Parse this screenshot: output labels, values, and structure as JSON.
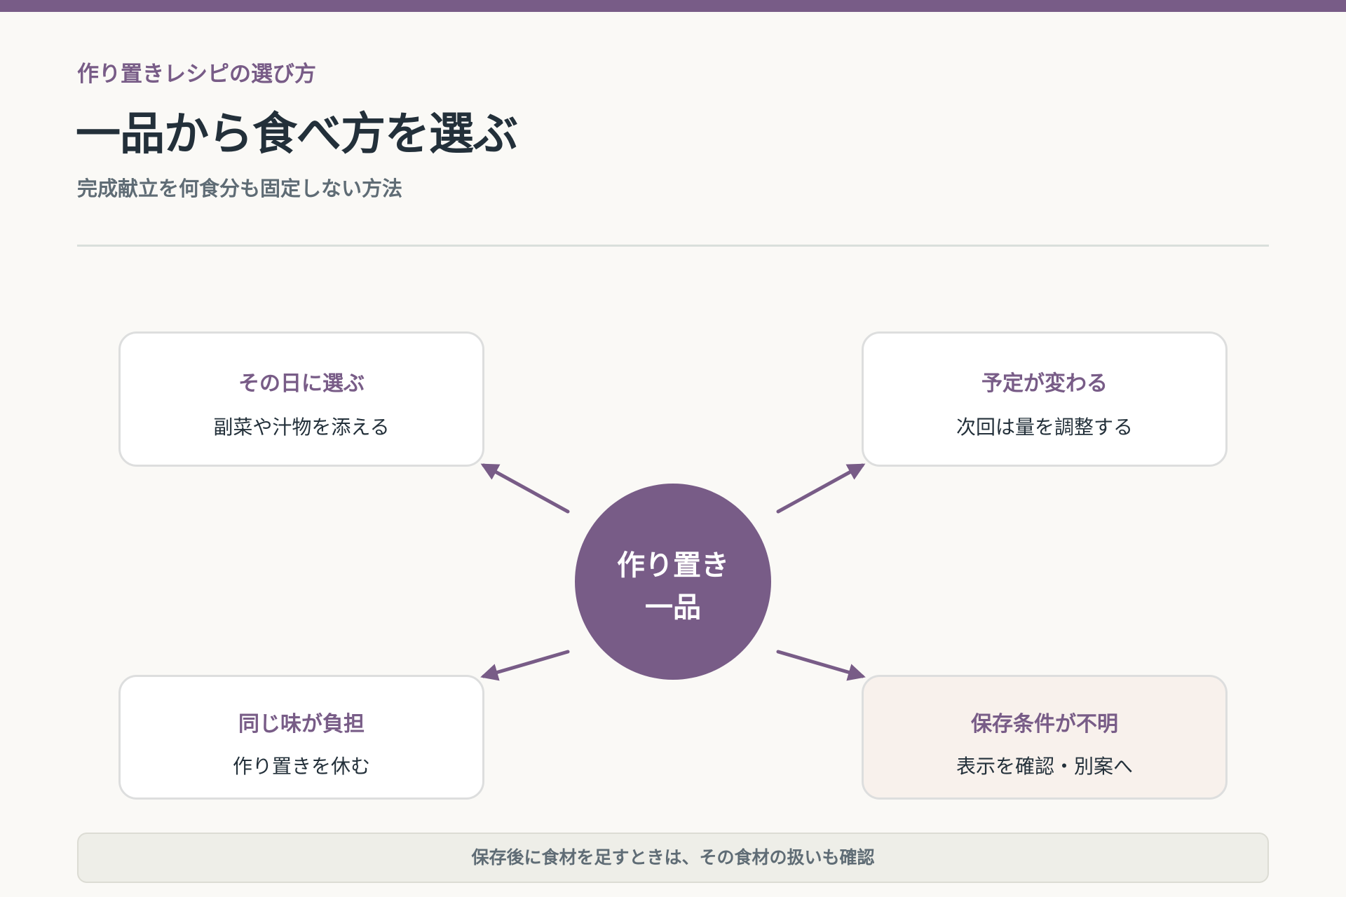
{
  "header": {
    "eyebrow": "作り置きレシピの選び方",
    "title": "一品から食べ方を選ぶ",
    "subtitle": "完成献立を何食分も固定しない方法"
  },
  "diagram": {
    "hub": {
      "line1": "作り置き",
      "line2": "一品"
    },
    "branches": [
      {
        "title": "その日に選ぶ",
        "text": "副菜や汁物を添える"
      },
      {
        "title": "予定が変わる",
        "text": "次回は量を調整する"
      },
      {
        "title": "同じ味が負担",
        "text": "作り置きを休む"
      },
      {
        "title": "保存条件が不明",
        "text": "表示を確認・別案へ"
      }
    ]
  },
  "footer": {
    "note": "保存後に食材を足すときは、その食材の扱いも確認"
  },
  "colors": {
    "accent": "#785c87",
    "text_dark": "#23303a",
    "text_muted": "#5f6c75",
    "card_border": "#dddede",
    "warning_card_bg": "#f8f1ec",
    "page_bg": "#faf9f6"
  }
}
